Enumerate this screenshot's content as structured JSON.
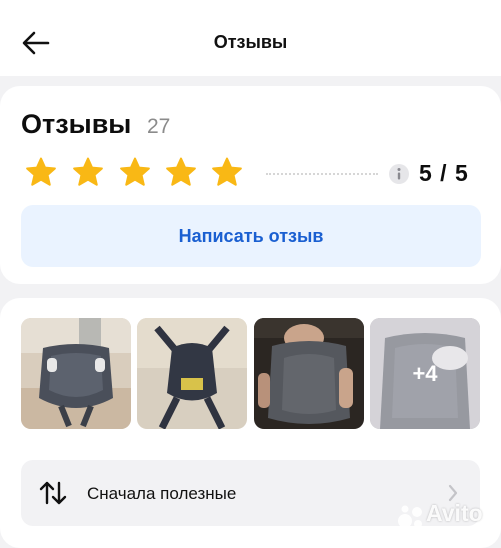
{
  "header": {
    "title": "Отзывы"
  },
  "summary": {
    "heading": "Отзывы",
    "count": "27",
    "rating_text": "5 / 5",
    "rating_value": 5,
    "rating_max": 5,
    "star_color": "#f9b815",
    "write_review_label": "Написать отзыв"
  },
  "photos": {
    "more_label": "+4"
  },
  "sort": {
    "label": "Сначала полезные"
  },
  "watermark": {
    "text": "Avito"
  },
  "colors": {
    "accent": "#1a5fd1",
    "accent_bg": "#eaf3ff",
    "page_bg": "#f2f2f4"
  }
}
